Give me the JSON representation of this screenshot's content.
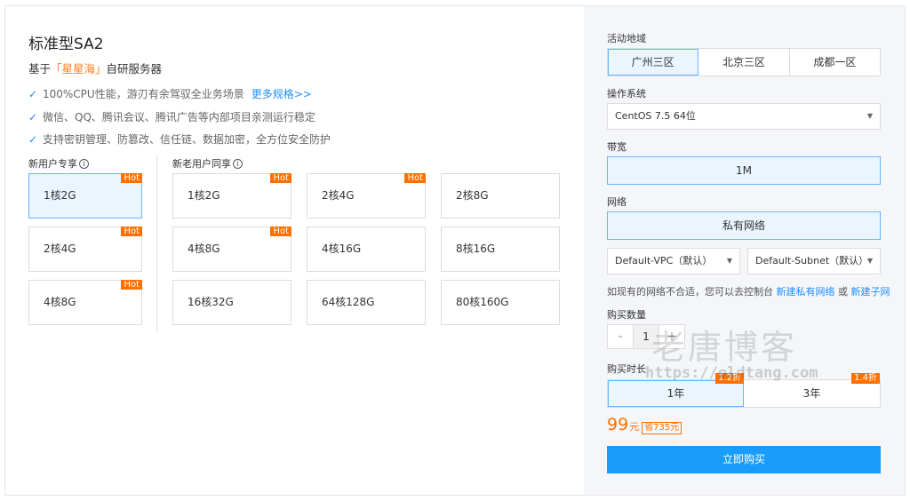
{
  "product": {
    "title": "标准型SA2",
    "subtitle_prefix": "基于",
    "subtitle_highlight": "「星星海」",
    "subtitle_suffix": "自研服务器",
    "features": [
      "100%CPU性能，游刃有余驾驭全业务场景",
      "微信、QQ、腾讯会议、腾讯广告等内部项目亲测运行稳定",
      "支持密钥管理、防篡改、信任链、数据加密，全方位安全防护"
    ],
    "more_link": "更多规格>>",
    "accent_color": "#1f8fff",
    "hot_color": "#ff7000"
  },
  "new_user": {
    "label": "新用户专享",
    "specs": [
      {
        "label": "1核2G",
        "hot": "Hot"
      },
      {
        "label": "2核4G",
        "hot": "Hot"
      },
      {
        "label": "4核8G",
        "hot": "Hot"
      }
    ]
  },
  "all_users": {
    "label": "新老用户同享",
    "specs": [
      {
        "label": "1核2G",
        "hot": "Hot"
      },
      {
        "label": "2核4G",
        "hot": "Hot"
      },
      {
        "label": "2核8G",
        "hot": ""
      },
      {
        "label": "4核8G",
        "hot": "Hot"
      },
      {
        "label": "4核16G",
        "hot": ""
      },
      {
        "label": "8核16G",
        "hot": ""
      },
      {
        "label": "16核32G",
        "hot": ""
      },
      {
        "label": "64核128G",
        "hot": ""
      },
      {
        "label": "80核160G",
        "hot": ""
      }
    ]
  },
  "config": {
    "region_label": "活动地域",
    "regions": [
      "广州三区",
      "北京三区",
      "成都一区"
    ],
    "os_label": "操作系统",
    "os_value": "CentOS 7.5 64位",
    "bandwidth_label": "带宽",
    "bandwidth_value": "1M",
    "network_label": "网络",
    "network_value": "私有网络",
    "vpc_value": "Default-VPC（默认）",
    "subnet_value": "Default-Subnet（默认）",
    "hint_text": "如现有的网络不合适，您可以去控制台",
    "hint_link1": "新建私有网络",
    "hint_or": "或",
    "hint_link2": "新建子网",
    "qty_label": "购买数量",
    "qty_minus": "-",
    "qty_value": "1",
    "qty_plus": "+",
    "duration_label": "购买时长",
    "durations": [
      {
        "label": "1年",
        "discount": "1.2折"
      },
      {
        "label": "3年",
        "discount": "1.4折"
      }
    ],
    "price": "99",
    "price_unit": "元",
    "save_text": "省735元",
    "buy_label": "立即购买"
  },
  "watermark": {
    "text": "老唐博客",
    "url": "https://oldtang.com"
  }
}
